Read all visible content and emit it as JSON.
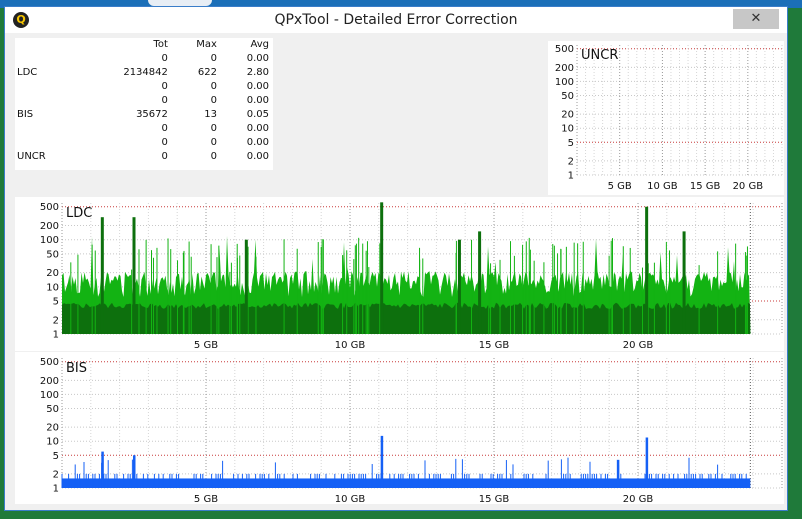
{
  "window": {
    "title": "QPxTool - Detailed Error Correction",
    "close_glyph": "✕",
    "app_icon_letter": "Q"
  },
  "stats": {
    "headers": [
      "",
      "Tot",
      "Max",
      "Avg"
    ],
    "rows": [
      [
        "",
        "0",
        "0",
        "0.00"
      ],
      [
        "LDC",
        "2134842",
        "622",
        "2.80"
      ],
      [
        "",
        "0",
        "0",
        "0.00"
      ],
      [
        "",
        "0",
        "0",
        "0.00"
      ],
      [
        "BIS",
        "35672",
        "13",
        "0.05"
      ],
      [
        "",
        "0",
        "0",
        "0.00"
      ],
      [
        "",
        "0",
        "0",
        "0.00"
      ],
      [
        "UNCR",
        "0",
        "0",
        "0.00"
      ]
    ]
  },
  "chart_data": [
    {
      "type": "area",
      "title": "UNCR",
      "y_scale": "log",
      "ylim": [
        1,
        600
      ],
      "y_ticks": [
        "500",
        "200",
        "100",
        "50",
        "20",
        "10",
        "5",
        "2",
        "1"
      ],
      "xlim": [
        0,
        24
      ],
      "x_ticks": [
        "5 GB",
        "10 GB",
        "15 GB",
        "20 GB"
      ],
      "series": [
        {
          "color": "#00aa00",
          "values": []
        }
      ]
    },
    {
      "type": "area",
      "title": "LDC",
      "y_scale": "log",
      "ylim": [
        1,
        600
      ],
      "y_ticks": [
        "500",
        "200",
        "100",
        "50",
        "20",
        "10",
        "5",
        "2",
        "1"
      ],
      "xlim": [
        0,
        25
      ],
      "x_ticks": [
        "5 GB",
        "10 GB",
        "15 GB",
        "20 GB"
      ],
      "data_end_gb": 23.9,
      "series": [
        {
          "color": "#13b313",
          "base_level": 12,
          "values": []
        },
        {
          "color": "#0d700d",
          "base_level": 4,
          "values": []
        }
      ],
      "spikes": [
        {
          "x_gb": 1.4,
          "value": 300
        },
        {
          "x_gb": 2.5,
          "value": 300
        },
        {
          "x_gb": 11.1,
          "value": 620
        },
        {
          "x_gb": 20.3,
          "value": 500
        },
        {
          "x_gb": 6.4,
          "value": 100
        },
        {
          "x_gb": 14.5,
          "value": 150
        },
        {
          "x_gb": 21.6,
          "value": 150
        },
        {
          "x_gb": 13.8,
          "value": 100
        }
      ]
    },
    {
      "type": "bar",
      "title": "BIS",
      "y_scale": "log",
      "ylim": [
        1,
        600
      ],
      "y_ticks": [
        "500",
        "200",
        "100",
        "50",
        "20",
        "10",
        "5",
        "2",
        "1"
      ],
      "xlim": [
        0,
        25
      ],
      "x_ticks": [
        "5 GB",
        "10 GB",
        "15 GB",
        "20 GB"
      ],
      "data_end_gb": 23.9,
      "series": [
        {
          "color": "#1560f5",
          "base_level": 2,
          "values": []
        }
      ],
      "spikes": [
        {
          "x_gb": 1.4,
          "value": 6
        },
        {
          "x_gb": 2.5,
          "value": 5
        },
        {
          "x_gb": 11.1,
          "value": 13
        },
        {
          "x_gb": 20.3,
          "value": 12
        },
        {
          "x_gb": 19.3,
          "value": 4
        }
      ]
    }
  ]
}
